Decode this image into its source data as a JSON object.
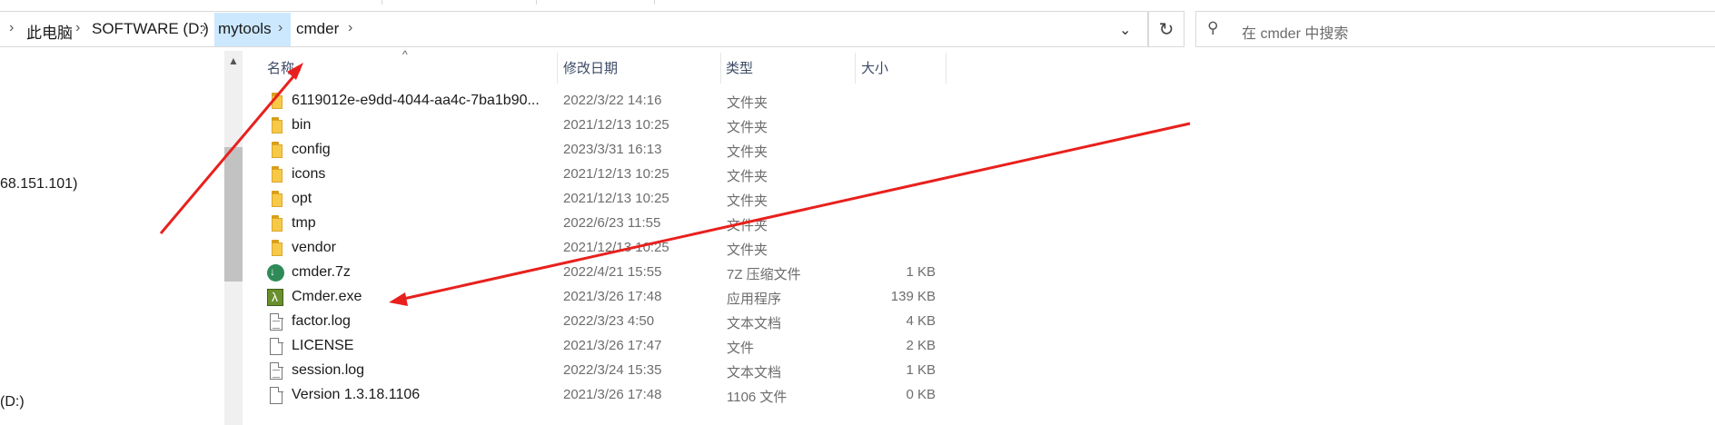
{
  "breadcrumb": {
    "items": [
      "此电脑",
      "SOFTWARE (D:)",
      "mytools",
      "cmder"
    ],
    "separator": "›"
  },
  "search": {
    "placeholder": "在 cmder 中搜索"
  },
  "left_pane": {
    "ip_fragment": "68.151.101)",
    "drive_fragment": "(D:)"
  },
  "columns": {
    "name": "名称",
    "modified": "修改日期",
    "type": "类型",
    "size": "大小"
  },
  "files": [
    {
      "name": "6119012e-e9dd-4044-aa4c-7ba1b90...",
      "modified": "2022/3/22 14:16",
      "type": "文件夹",
      "size": "",
      "icon": "folder-icon"
    },
    {
      "name": "bin",
      "modified": "2021/12/13 10:25",
      "type": "文件夹",
      "size": "",
      "icon": "folder-icon"
    },
    {
      "name": "config",
      "modified": "2023/3/31 16:13",
      "type": "文件夹",
      "size": "",
      "icon": "folder-icon"
    },
    {
      "name": "icons",
      "modified": "2021/12/13 10:25",
      "type": "文件夹",
      "size": "",
      "icon": "folder-icon"
    },
    {
      "name": "opt",
      "modified": "2021/12/13 10:25",
      "type": "文件夹",
      "size": "",
      "icon": "folder-icon"
    },
    {
      "name": "tmp",
      "modified": "2022/6/23 11:55",
      "type": "文件夹",
      "size": "",
      "icon": "folder-icon"
    },
    {
      "name": "vendor",
      "modified": "2021/12/13 10:25",
      "type": "文件夹",
      "size": "",
      "icon": "folder-icon"
    },
    {
      "name": "cmder.7z",
      "modified": "2022/4/21 15:55",
      "type": "7Z 压缩文件",
      "size": "1 KB",
      "icon": "archive-7z-icon"
    },
    {
      "name": "Cmder.exe",
      "modified": "2021/3/26 17:48",
      "type": "应用程序",
      "size": "139 KB",
      "icon": "cmder-app-icon"
    },
    {
      "name": "factor.log",
      "modified": "2022/3/23 4:50",
      "type": "文本文档",
      "size": "4 KB",
      "icon": "text-file-icon"
    },
    {
      "name": "LICENSE",
      "modified": "2021/3/26 17:47",
      "type": "文件",
      "size": "2 KB",
      "icon": "file-icon"
    },
    {
      "name": "session.log",
      "modified": "2022/3/24 15:35",
      "type": "文本文档",
      "size": "1 KB",
      "icon": "text-file-icon"
    },
    {
      "name": "Version 1.3.18.1106",
      "modified": "2021/3/26 17:48",
      "type": "1106 文件",
      "size": "0 KB",
      "icon": "file-icon"
    }
  ],
  "annotation_color": "#e8201d",
  "selection_color": "#cce8ff"
}
